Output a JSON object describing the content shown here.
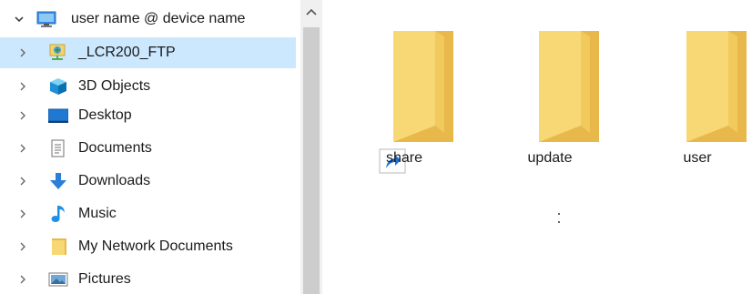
{
  "navigation": {
    "device": {
      "label": "user name @ device name",
      "icon": "computer-icon",
      "expanded": true
    },
    "items": [
      {
        "label": "_LCR200_FTP",
        "icon": "network-drive-icon",
        "selected": true
      },
      {
        "label": "3D Objects",
        "icon": "3d-objects-icon",
        "selected": false
      },
      {
        "label": "Desktop",
        "icon": "desktop-icon",
        "selected": false
      },
      {
        "label": "Documents",
        "icon": "documents-icon",
        "selected": false
      },
      {
        "label": "Downloads",
        "icon": "downloads-icon",
        "selected": false
      },
      {
        "label": "Music",
        "icon": "music-icon",
        "selected": false
      },
      {
        "label": "My Network Documents",
        "icon": "folder-icon",
        "selected": false
      },
      {
        "label": "Pictures",
        "icon": "pictures-icon",
        "selected": false
      }
    ]
  },
  "content": {
    "folders": [
      {
        "name": "share",
        "shortcut": true
      },
      {
        "name": "update",
        "shortcut": false
      },
      {
        "name": "user",
        "shortcut": false
      }
    ]
  },
  "colors": {
    "selection": "#cce8ff",
    "folder_body": "#f8d775",
    "folder_back": "#e8b84a",
    "scrollbar_track": "#f0f0f0",
    "scrollbar_thumb": "#cdcdcd"
  }
}
